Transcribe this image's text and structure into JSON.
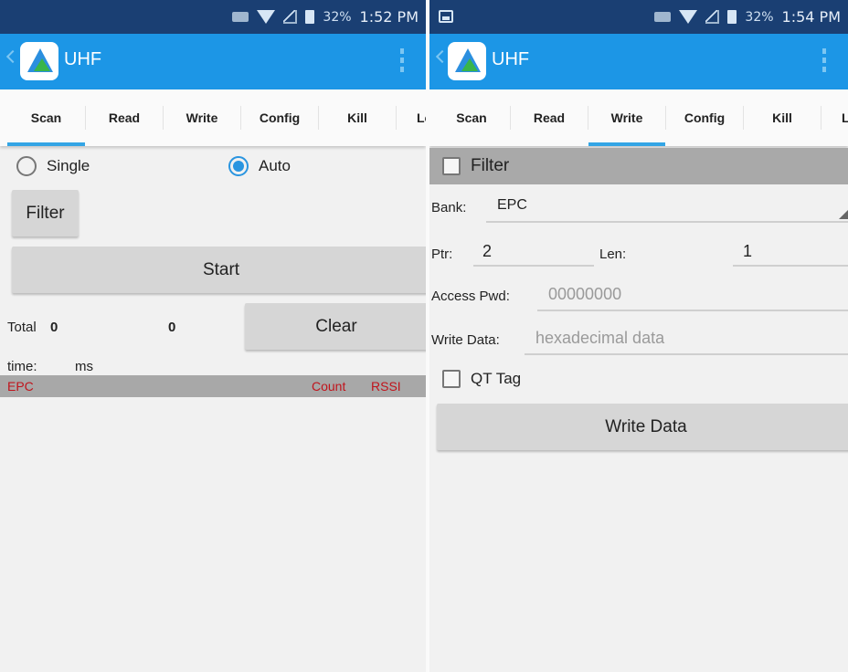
{
  "left_screen": {
    "status_bar": {
      "battery_pct": "32%",
      "time": "1:52 PM"
    },
    "app_title": "UHF",
    "tabs": [
      "Scan",
      "Read",
      "Write",
      "Config",
      "Kill",
      "Lo"
    ],
    "active_tab": "Scan",
    "mode": {
      "single_label": "Single",
      "auto_label": "Auto",
      "selected": "Auto"
    },
    "filter_button": "Filter",
    "start_button": "Start",
    "total_label": "Total",
    "total_value": "0",
    "count_value": "0",
    "clear_button": "Clear",
    "time_label": "time:",
    "time_unit": "ms",
    "table_headers": {
      "epc": "EPC",
      "count": "Count",
      "rssi": "RSSI"
    }
  },
  "right_screen": {
    "status_bar": {
      "battery_pct": "32%",
      "time": "1:54 PM"
    },
    "app_title": "UHF",
    "tabs": [
      "Scan",
      "Read",
      "Write",
      "Config",
      "Kill",
      "L"
    ],
    "active_tab": "Write",
    "filter_label": "Filter",
    "bank_label": "Bank:",
    "bank_value": "EPC",
    "ptr_label": "Ptr:",
    "ptr_value": "2",
    "len_label": "Len:",
    "len_value": "1",
    "access_pwd_label": "Access Pwd:",
    "access_pwd_placeholder": "00000000",
    "write_data_label": "Write Data:",
    "write_data_placeholder": "hexadecimal data",
    "qt_tag_label": "QT Tag",
    "write_button": "Write Data"
  },
  "colors": {
    "status_bar": "#1a3f73",
    "app_bar": "#1c96e6",
    "tab_indicator": "#33a5e5",
    "header_text": "#c0141c"
  }
}
